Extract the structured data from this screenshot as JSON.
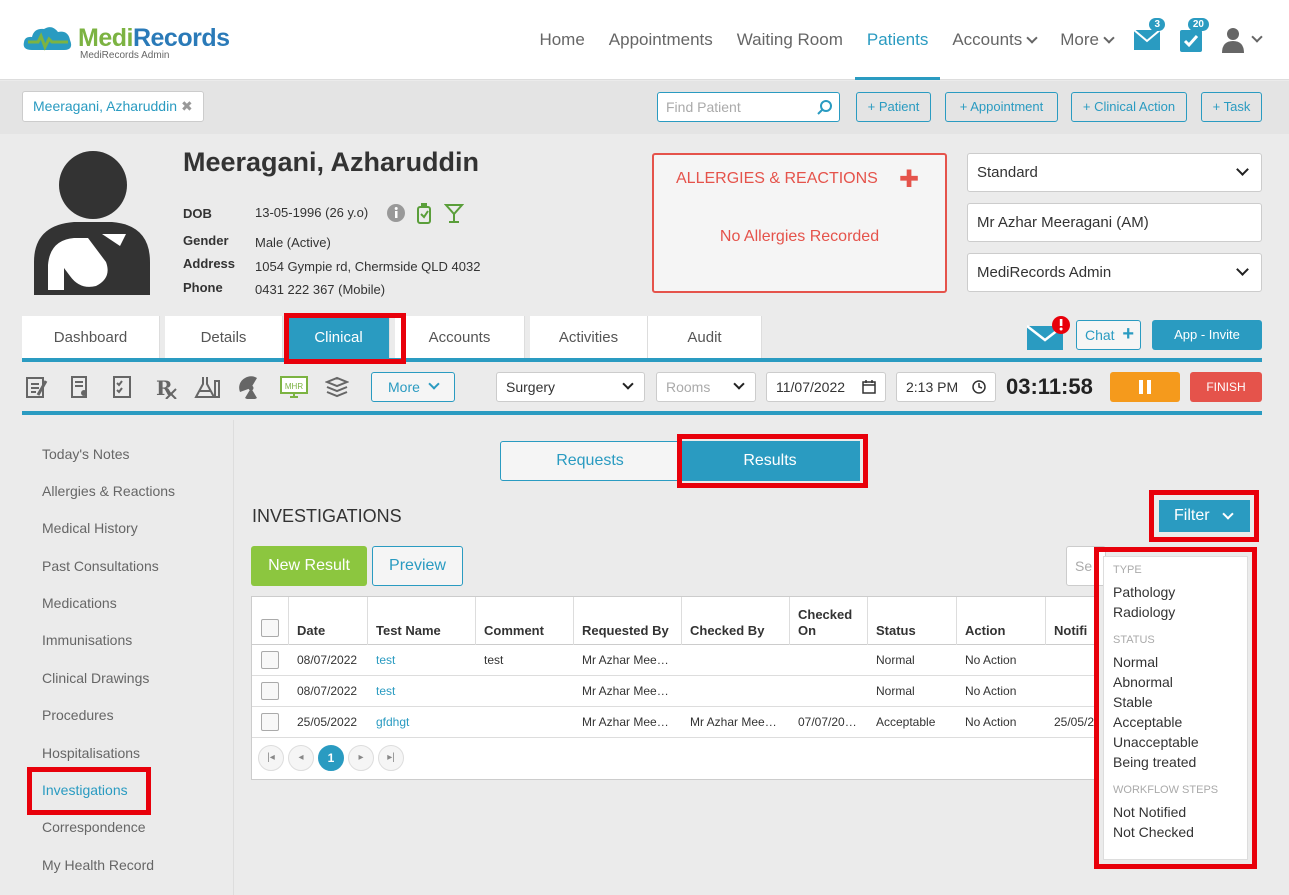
{
  "header": {
    "brand_part1": "Medi",
    "brand_part2": "Records",
    "brand_sub": "MediRecords Admin",
    "nav": [
      "Home",
      "Appointments",
      "Waiting Room",
      "Patients",
      "Accounts",
      "More"
    ],
    "messages_count": "3",
    "tasks_count": "20"
  },
  "patient_bar": {
    "open_patient": "Meeragani, Azharuddin",
    "find_placeholder": "Find Patient",
    "buttons": [
      "+ Patient",
      "+ Appointment",
      "+ Clinical Action",
      "+ Task"
    ]
  },
  "patient": {
    "name": "Meeragani, Azharuddin",
    "dob_label": "DOB",
    "dob": "13-05-1996 (26 y.o)",
    "gender_label": "Gender",
    "gender": "Male (Active)",
    "address_label": "Address",
    "address": "1054 Gympie rd, Chermside QLD 4032",
    "phone_label": "Phone",
    "phone": "0431 222 367 (Mobile)"
  },
  "allergies": {
    "title": "ALLERGIES & REACTIONS",
    "empty": "No Allergies Recorded"
  },
  "right_selects": {
    "billing": "Standard",
    "practitioner": "Mr Azhar Meeragani (AM)",
    "practice": "MediRecords Admin"
  },
  "tabs": [
    "Dashboard",
    "Details",
    "Clinical",
    "Accounts",
    "Activities",
    "Audit"
  ],
  "active_tab": "Clinical",
  "actions": {
    "chat": "Chat",
    "app_invite": "App - Invite"
  },
  "toolbar": {
    "more": "More",
    "mhr": "MHR",
    "location": "Surgery",
    "rooms_placeholder": "Rooms",
    "date": "11/07/2022",
    "time": "2:13 PM",
    "timer": "03:11:58",
    "finish": "FINISH"
  },
  "sidebar": {
    "items": [
      "Today's Notes",
      "Allergies & Reactions",
      "Medical History",
      "Past Consultations",
      "Medications",
      "Immunisations",
      "Clinical Drawings",
      "Procedures",
      "Hospitalisations",
      "Investigations",
      "Correspondence",
      "My Health Record"
    ],
    "active": "Investigations"
  },
  "main": {
    "segments": [
      "Requests",
      "Results"
    ],
    "active_segment": "Results",
    "section_title": "INVESTIGATIONS",
    "filter": "Filter",
    "new_result": "New Result",
    "preview": "Preview",
    "search_partial": "Se",
    "columns": [
      "Date",
      "Test Name",
      "Comment",
      "Requested By",
      "Checked By",
      "Checked On",
      "Status",
      "Action",
      "Notifi"
    ],
    "rows": [
      {
        "date": "08/07/2022",
        "test": "test",
        "comment": "test",
        "requested_by": "Mr Azhar Mee…",
        "checked_by": "",
        "checked_on": "",
        "status": "Normal",
        "action": "No Action",
        "notified": ""
      },
      {
        "date": "08/07/2022",
        "test": "test",
        "comment": "",
        "requested_by": "Mr Azhar Mee…",
        "checked_by": "",
        "checked_on": "",
        "status": "Normal",
        "action": "No Action",
        "notified": ""
      },
      {
        "date": "25/05/2022",
        "test": "gfdhgt",
        "comment": "",
        "requested_by": "Mr Azhar Mee…",
        "checked_by": "Mr Azhar Mee…",
        "checked_on": "07/07/20…",
        "status": "Acceptable",
        "action": "No Action",
        "notified": "25/05/2"
      }
    ],
    "current_page": "1"
  },
  "filter_menu": {
    "type_header": "TYPE",
    "type_items": [
      "Pathology",
      "Radiology"
    ],
    "status_header": "STATUS",
    "status_items": [
      "Normal",
      "Abnormal",
      "Stable",
      "Acceptable",
      "Unacceptable",
      "Being treated"
    ],
    "workflow_header": "WORKFLOW STEPS",
    "workflow_items": [
      "Not Notified",
      "Not Checked"
    ]
  },
  "colors": {
    "primary": "#2a9bc1",
    "brand_green": "#7cb342",
    "danger": "#e5534b",
    "highlight": "#e8000b",
    "pause": "#f59a1c",
    "new_result": "#8cc63f"
  }
}
